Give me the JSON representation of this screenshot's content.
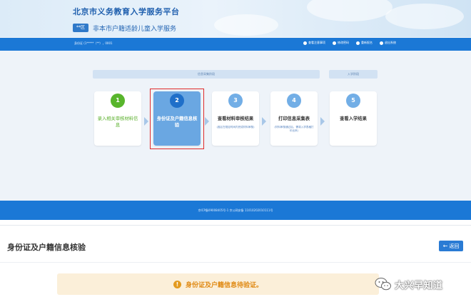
{
  "header": {
    "site_title": "北京市义务教育入学服务平台",
    "district_badge": "**区",
    "service_name": "非本市户籍适龄儿童入学服务"
  },
  "navbar": {
    "user_info": "身份证 (1*****（**），0001",
    "links": [
      "查看注意事项",
      "修改密码",
      "重新报名",
      "退出系统"
    ]
  },
  "phases": [
    "信息采集阶段",
    "入学阶段"
  ],
  "steps": [
    {
      "number": "1",
      "title": "录入相关审核材料信息",
      "subtitle": "",
      "state": "done",
      "color": "#58b52c"
    },
    {
      "number": "2",
      "title": "身份证及户籍信息核验",
      "subtitle": "",
      "state": "active",
      "color": "#1f6fc9"
    },
    {
      "number": "3",
      "title": "查看材料审核结果",
      "subtitle": "(各区在规定时间内完成材料审核)",
      "state": "pending",
      "color": "#72aee6"
    },
    {
      "number": "4",
      "title": "打印信息采集表",
      "subtitle": "(材料审核通过后，需将入学表格打印出来)",
      "state": "pending",
      "color": "#72aee6"
    },
    {
      "number": "5",
      "title": "查看入学结果",
      "subtitle": "",
      "state": "pending",
      "color": "#72aee6"
    }
  ],
  "footer": {
    "text": "京ICP备09008405号-1 京公网安备 11010202010111号"
  },
  "panel": {
    "title": "身份证及户籍信息核验",
    "back_label": "返回",
    "alert_message": "身份证及户籍信息待验证。"
  },
  "watermark": {
    "text": "大兴早知道"
  },
  "colors": {
    "primary": "#1b78d6",
    "alert_bg": "#fbefd9",
    "alert_text": "#e08a14",
    "highlight": "#e02b2b"
  }
}
